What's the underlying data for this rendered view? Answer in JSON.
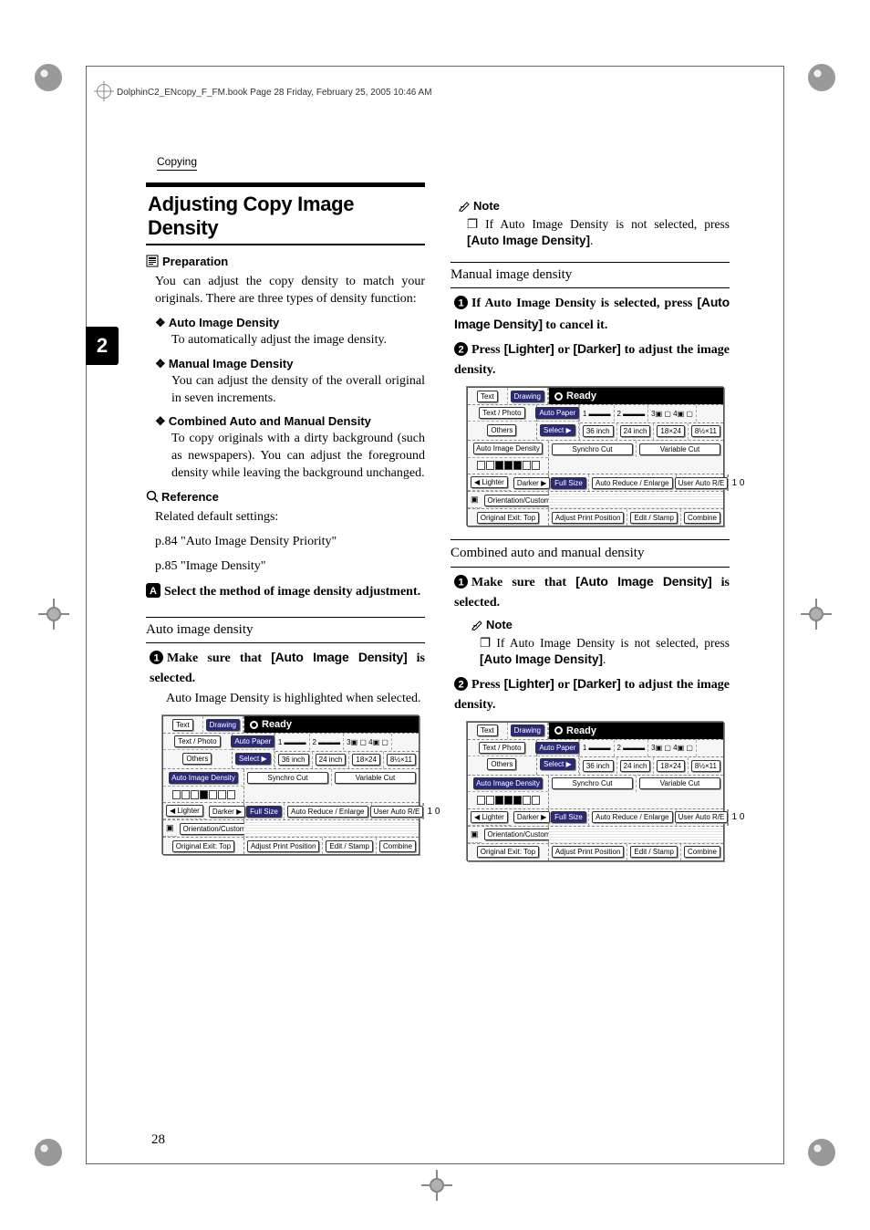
{
  "running_head": "DolphinC2_ENcopy_F_FM.book  Page 28  Friday, February 25, 2005  10:46 AM",
  "section_head": "Copying",
  "chapter_tab": "2",
  "page_number": "28",
  "left": {
    "title": "Adjusting Copy Image Density",
    "prep_label": "Preparation",
    "prep_body": "You can adjust the copy density to match your originals. There are three types of density function:",
    "d1_label": "Auto Image Density",
    "d1_body": "To automatically adjust the image density.",
    "d2_label": "Manual Image Density",
    "d2_body": "You can adjust the density of the overall original in seven increments.",
    "d3_label": "Combined Auto and Manual Density",
    "d3_body": "To copy originals with a dirty background (such as newspapers). You can adjust the foreground density while leaving the background unchanged.",
    "ref_label": "Reference",
    "ref_body1": "Related default settings:",
    "ref_body2": "p.84 \"Auto Image Density Priority\"",
    "ref_body3": "p.85 \"Image Density\"",
    "stepA": "Select the method of image density adjustment.",
    "sub_auto": "Auto image density",
    "auto_s1_a": "Make sure that ",
    "auto_s1_b": "[Auto Image Density]",
    "auto_s1_c": " is selected.",
    "auto_s1_body": "Auto Image Density is highlighted when selected."
  },
  "right": {
    "note_label": "Note",
    "note1_a": "If Auto Image Density is not selected, press ",
    "note1_b": "[Auto Image Density]",
    "note1_c": ".",
    "sub_manual": "Manual image density",
    "man_s1_a": "If Auto Image Density is selected, press ",
    "man_s1_b": "[Auto Image Density]",
    "man_s1_c": " to cancel it.",
    "man_s2_a": "Press ",
    "man_s2_b": "[Lighter]",
    "man_s2_c": " or ",
    "man_s2_d": "[Darker]",
    "man_s2_e": " to adjust the image density.",
    "sub_combined": "Combined auto and manual density",
    "comb_s1_a": "Make sure that ",
    "comb_s1_b": "[Auto Image Density]",
    "comb_s1_c": " is selected.",
    "comb_note_a": "If Auto Image Density is not selected, press ",
    "comb_note_b": "[Auto Image Density]",
    "comb_note_c": ".",
    "comb_s2_a": "Press ",
    "comb_s2_b": "[Lighter]",
    "comb_s2_c": " or ",
    "comb_s2_d": "[Darker]",
    "comb_s2_e": " to adjust the image density."
  },
  "ui": {
    "ready": "Ready",
    "text": "Text",
    "drawing": "Drawing",
    "text_photo": "Text / Photo",
    "others": "Others",
    "auto_paper": "Auto Paper",
    "select": "Select ▶",
    "roll1": "1 ▬▬▬",
    "roll2": "2 ▬▬▬",
    "size1": "3▣ ▢ 4▣ ▢",
    "inch36": "36 inch",
    "inch24": "24 inch",
    "p18x24": "18×24",
    "p85x11": "8½×11",
    "auto_density": "Auto Image Density",
    "synchro": "Synchro Cut",
    "variable": "Variable Cut",
    "lighter": "◀ Lighter",
    "darker": "Darker ▶",
    "full_size": "Full Size",
    "auto_reduce": "Auto Reduce / Enlarge",
    "user_auto": "User Auto R/E",
    "count": "1 0",
    "orientation": "Orientation/Custom",
    "orig_exit": "Original Exit: Top",
    "adj_print": "Adjust Print Position",
    "edit_stamp": "Edit / Stamp",
    "combine": "Combine",
    "orient_icon": "▣"
  }
}
